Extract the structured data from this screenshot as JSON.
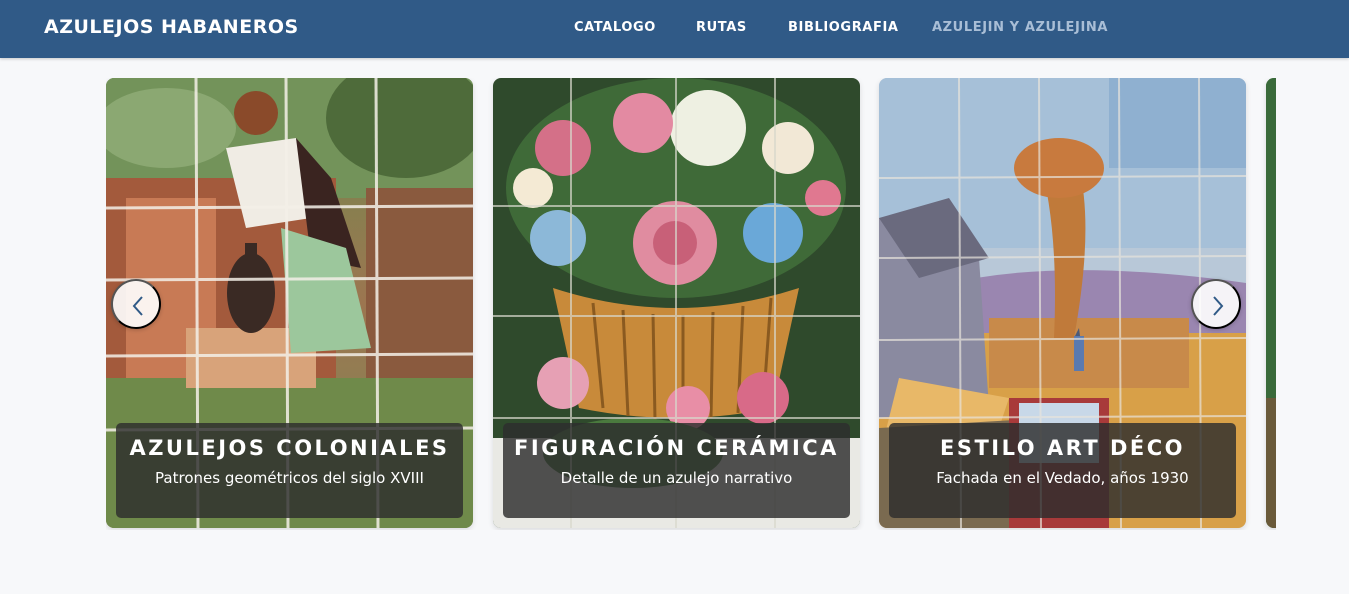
{
  "navbar": {
    "brand": "AZULEJOS HABANEROS",
    "links": [
      {
        "label": "CATALOGO",
        "active": false
      },
      {
        "label": "RUTAS",
        "active": false
      },
      {
        "label": "BIBLIOGRAFIA",
        "active": false
      },
      {
        "label": "AZULEJIN Y AZULEJINA",
        "active": true
      }
    ],
    "color": "#305a87"
  },
  "carousel": {
    "cards": [
      {
        "title": "AZULEJOS COLONIALES",
        "subtitle": "Patrones geométricos del siglo XVIII",
        "image": "painted tile mural of a woman at a fountain"
      },
      {
        "title": "FIGURACIÓN CERÁMICA",
        "subtitle": "Detalle de un azulejo narrativo",
        "image": "painted tile mural of a flower basket"
      },
      {
        "title": "ESTILO ART DÉCO",
        "subtitle": "Fachada en el Vedado, años 1930",
        "image": "painted tile mural of a rural landscape"
      }
    ],
    "prev_icon": "chevron-left-icon",
    "next_icon": "chevron-right-icon"
  }
}
